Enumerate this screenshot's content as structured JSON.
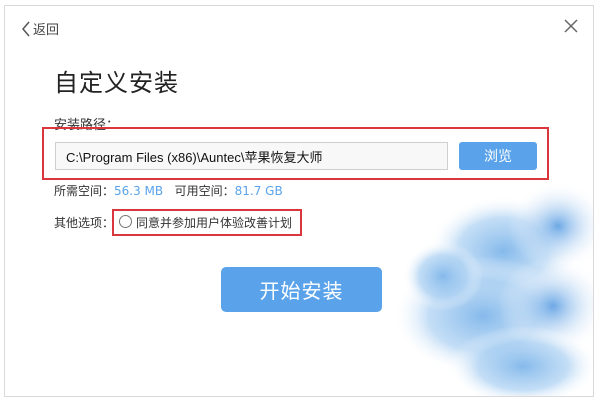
{
  "header": {
    "back_label": "返回"
  },
  "main": {
    "title": "自定义安装",
    "path_label": "安装路径：",
    "path_value": "C:\\Program Files (x86)\\Auntec\\苹果恢复大师",
    "browse_label": "浏览",
    "space": {
      "required_label": "所需空间：",
      "required_value": "56.3 MB",
      "available_label": "可用空间：",
      "available_value": "81.7 GB"
    },
    "options_label": "其他选项：",
    "option_text": "同意并参加用户体验改善计划",
    "start_label": "开始安装"
  },
  "colors": {
    "accent": "#5aa3ea",
    "highlight_box": "#d9363e"
  }
}
